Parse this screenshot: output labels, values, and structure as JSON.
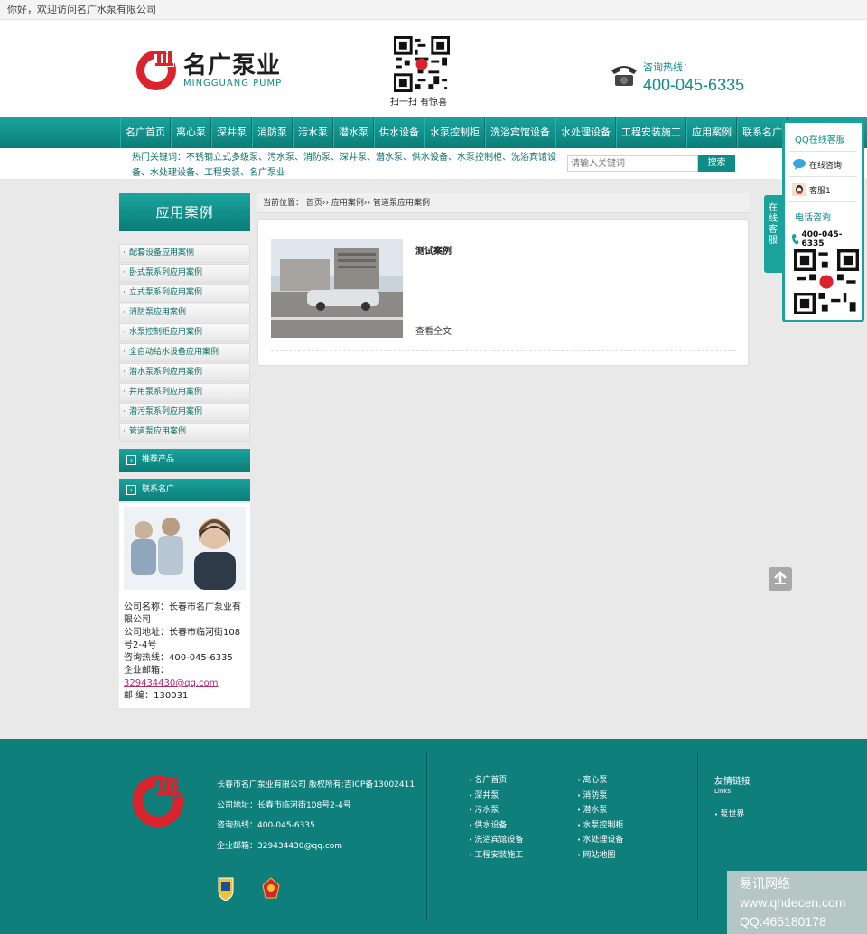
{
  "topbar": {
    "greeting": "你好，欢迎访问名广水泵有限公司"
  },
  "header": {
    "logo_cn": "名广泵业",
    "logo_en": "MINGGUANG   PUMP",
    "qr_caption": "扫一扫  有惊喜",
    "hotline_label": "咨询热线：",
    "hotline_number": "400-045-6335"
  },
  "nav": {
    "items": [
      "名广首页",
      "离心泵",
      "深井泵",
      "消防泵",
      "污水泵",
      "潜水泵",
      "供水设备",
      "水泵控制柜",
      "洗浴宾馆设备",
      "水处理设备",
      "工程安装施工",
      "应用案例",
      "联系名广"
    ]
  },
  "keywords": {
    "text": "热门关键词：不锈钢立式多级泵、污水泵、消防泵、深井泵、潜水泵、供水设备、水泵控制柜、洗浴宾馆设备、水处理设备、工程安装、名广泵业",
    "search_placeholder": "请输入关键词",
    "search_button": "搜索"
  },
  "sidebar": {
    "title": "应用案例",
    "items": [
      "配套设备应用案例",
      "卧式泵系列应用案例",
      "立式泵系列应用案例",
      "消防泵应用案例",
      "水泵控制柜应用案例",
      "全自动给水设备应用案例",
      "潜水泵系列应用案例",
      "井用泵系列应用案例",
      "潜污泵系列应用案例",
      "管道泵应用案例"
    ],
    "recommend_title": "推荐产品",
    "contact_title": "联系名广",
    "contact": {
      "company": "公司名称：长春市名广泵业有限公司",
      "address": "公司地址：长春市临河街108号2-4号",
      "phone": "咨询热线：400-045-6335",
      "email_label": "企业邮箱：",
      "email": "329434430@qq.com",
      "postcode": "邮    编：130031"
    }
  },
  "breadcrumb": {
    "text": "当前位置： 首页›› 应用案例›› 管道泵应用案例"
  },
  "case": {
    "title": "测试案例",
    "more": "查看全文"
  },
  "qq_panel": {
    "title": "QQ在线客服",
    "consult": "在线咨询",
    "agent": "客服1",
    "tel_title": "电话咨询",
    "tel": "400-045-6335",
    "tab": "在线客服"
  },
  "footer": {
    "line1": "长春市名广泵业有限公司    版权所有:吉ICP备13002411",
    "line2": "公司地址：长春市临河街108号2-4号",
    "line3": "咨询热线：400-045-6335",
    "line4": "企业邮箱：329434430@qq.com",
    "links": [
      "名广首页",
      "离心泵",
      "深井泵",
      "消防泵",
      "污水泵",
      "潜水泵",
      "供水设备",
      "水泵控制柜",
      "洗浴宾馆设备",
      "水处理设备",
      "工程安装施工",
      "网站地图"
    ],
    "friend_title": "友情链接",
    "friend_sub": "Links",
    "friend_item": "泵世界"
  },
  "watermark": {
    "line1": "易讯网络",
    "line2": "www.qhdecen.com",
    "line3": "QQ:465180178"
  },
  "colors": {
    "brand": "#0f8c87",
    "logo_red": "#d9232d"
  }
}
